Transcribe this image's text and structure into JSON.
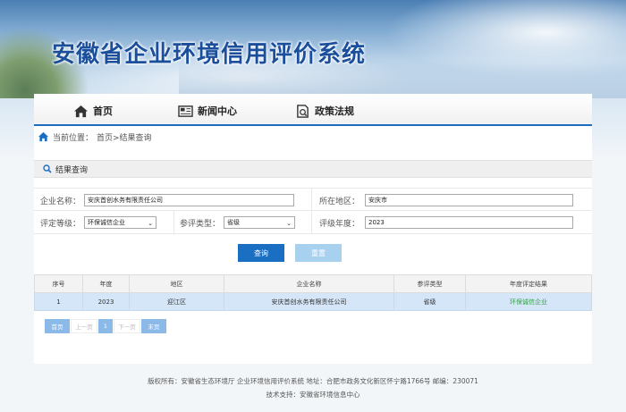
{
  "header": {
    "title": "安徽省企业环境信用评价系统"
  },
  "nav": {
    "home": "首页",
    "news": "新闻中心",
    "policy": "政策法规"
  },
  "breadcrumb": {
    "prefix": "当前位置：",
    "path": "首页>结果查询"
  },
  "section": {
    "title": "结果查询"
  },
  "form": {
    "company_label": "企业名称：",
    "company_value": "安庆首创水务有限责任公司",
    "region_label": "所在地区：",
    "region_value": "安庆市",
    "grade_label": "评定等级：",
    "grade_value": "环保诚信企业",
    "type_label": "参评类型：",
    "type_value": "省级",
    "year_label": "评级年度：",
    "year_value": "2023",
    "query_button": "查询",
    "reset_button": "重置"
  },
  "table": {
    "headers": [
      "序号",
      "年度",
      "地区",
      "企业名称",
      "参评类型",
      "年度评定结果"
    ],
    "rows": [
      [
        "1",
        "2023",
        "迎江区",
        "安庆首创水务有限责任公司",
        "省级",
        "环保诚信企业"
      ]
    ]
  },
  "pager": {
    "first": "首页",
    "prev": "上一页",
    "current": "1",
    "next": "下一页",
    "last": "末页"
  },
  "footer": {
    "line1": "版权所有：安徽省生态环境厅 企业环境信用评价系统 地址：合肥市政务文化新区怀宁路1766号 邮编：230071",
    "line2": "技术支持：安徽省环境信息中心"
  },
  "colors": {
    "accent": "#1b6fc3",
    "title": "#1b4f9b",
    "result_green": "#2fa340"
  }
}
